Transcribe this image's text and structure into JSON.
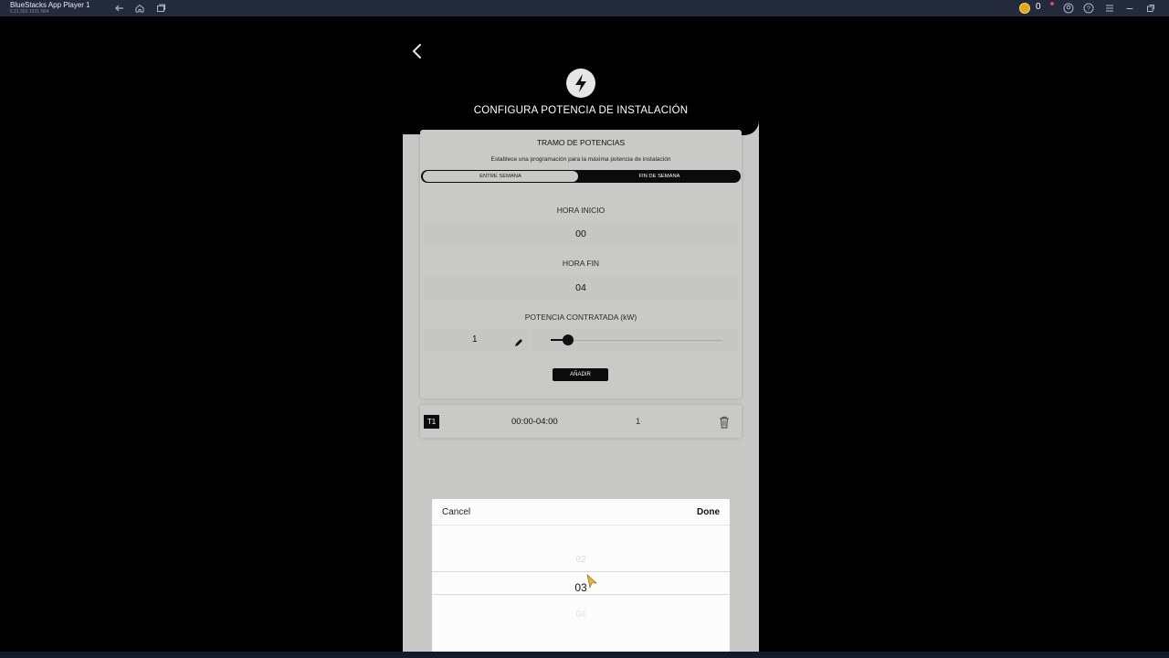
{
  "emulator": {
    "title": "BlueStacks App Player 1",
    "version": "5.21.550.1031 N64",
    "coins": "0"
  },
  "screen": {
    "title": "CONFIGURA POTENCIA DE INSTALACIÓN",
    "card": {
      "title": "TRAMO DE POTENCIAS",
      "subtitle": "Establece una programación para la máxima potencia de instalación",
      "tabs": [
        "ENTRE SEMANA",
        "FIN DE SEMANA"
      ],
      "selected_tab": "ENTRE SEMANA",
      "start_label": "HORA INICIO",
      "start_value": "00",
      "end_label": "HORA FIN",
      "end_value": "04",
      "power_label": "POTENCIA CONTRATADA (kW)",
      "power_value": "1",
      "add_button": "AÑADIR"
    },
    "entries": [
      {
        "tag": "T1",
        "time": "00:00-04:00",
        "value": "1"
      }
    ]
  },
  "picker": {
    "cancel": "Cancel",
    "done": "Done",
    "prev": "02",
    "current": "03",
    "next": "04"
  },
  "colors": {
    "titlebar": "#232a3b",
    "panel": "#c9c9c7",
    "dark": "#0b0b0b",
    "coin": "#e0a91c"
  }
}
